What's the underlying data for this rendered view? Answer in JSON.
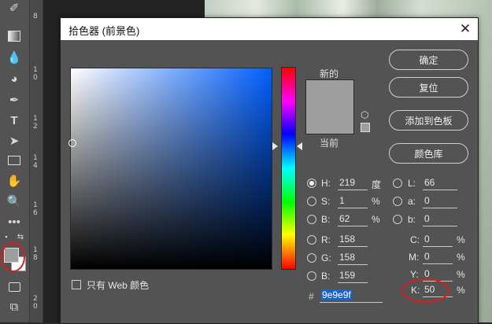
{
  "ruler": {
    "numbers": [
      "8",
      "1\n0",
      "1\n2",
      "1\n4",
      "1\n6",
      "1\n8",
      "2\n0"
    ]
  },
  "dialog": {
    "title": "拾色器 (前景色)",
    "close_glyph": "✕",
    "new_label": "新的",
    "current_label": "当前",
    "buttons": {
      "ok": "确定",
      "reset": "复位",
      "add_swatch": "添加到色板",
      "libraries": "颜色库"
    },
    "only_web": "只有 Web 颜色",
    "fields": {
      "H": {
        "label": "H:",
        "value": "219",
        "unit": "度"
      },
      "S": {
        "label": "S:",
        "value": "1",
        "unit": "%"
      },
      "B": {
        "label": "B:",
        "value": "62",
        "unit": "%"
      },
      "R": {
        "label": "R:",
        "value": "158"
      },
      "G": {
        "label": "G:",
        "value": "158"
      },
      "Bv": {
        "label": "B:",
        "value": "159"
      },
      "L": {
        "label": "L:",
        "value": "66"
      },
      "a": {
        "label": "a:",
        "value": "0"
      },
      "b": {
        "label": "b:",
        "value": "0"
      },
      "C": {
        "label": "C:",
        "value": "0",
        "unit": "%"
      },
      "M": {
        "label": "M:",
        "value": "0",
        "unit": "%"
      },
      "Y": {
        "label": "Y:",
        "value": "0",
        "unit": "%"
      },
      "K": {
        "label": "K:",
        "value": "50",
        "unit": "%"
      }
    },
    "hex_label": "#",
    "hex_value": "9e9e9f"
  },
  "colors": {
    "selected": "#9e9e9e",
    "annotation": "#d81e1e"
  }
}
